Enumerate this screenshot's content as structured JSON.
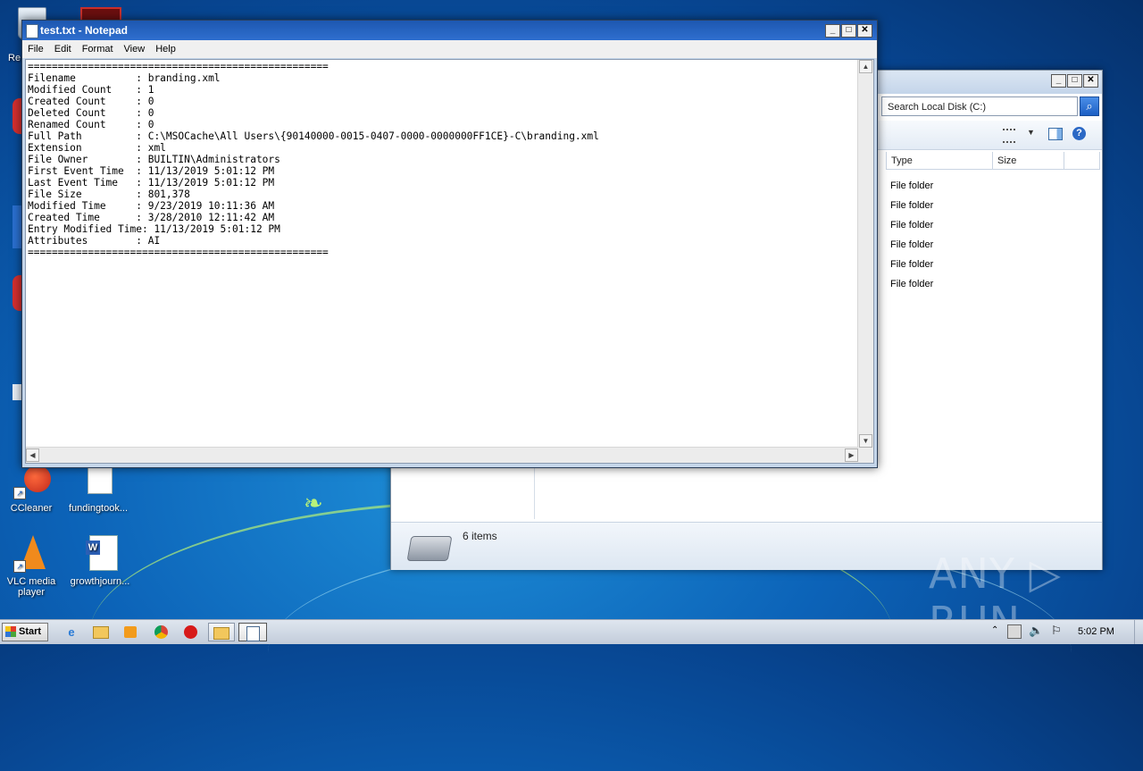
{
  "desktop": {
    "icons": [
      {
        "label": "Re"
      },
      {
        "label": "CCleaner"
      },
      {
        "label": "fundingtook..."
      },
      {
        "label": "VLC media player"
      },
      {
        "label": "growthjourn..."
      }
    ],
    "watermark": "ANY ▷ RUN"
  },
  "notepad": {
    "title": "test.txt - Notepad",
    "menu": [
      "File",
      "Edit",
      "Format",
      "View",
      "Help"
    ],
    "content": "==================================================\nFilename          : branding.xml\nModified Count    : 1\nCreated Count     : 0\nDeleted Count     : 0\nRenamed Count     : 0\nFull Path         : C:\\MSOCache\\All Users\\{90140000-0015-0407-0000-0000000FF1CE}-C\\branding.xml\nExtension         : xml\nFile Owner        : BUILTIN\\Administrators\nFirst Event Time  : 11/13/2019 5:01:12 PM\nLast Event Time   : 11/13/2019 5:01:12 PM\nFile Size         : 801,378\nModified Time     : 9/23/2019 10:11:36 AM\nCreated Time      : 3/28/2010 12:11:42 AM\nEntry Modified Time: 11/13/2019 5:01:12 PM\nAttributes        : AI\n=================================================="
  },
  "explorer": {
    "search_placeholder": "Search Local Disk (C:)",
    "columns": [
      "Type",
      "Size"
    ],
    "rows": [
      "File folder",
      "File folder",
      "File folder",
      "File folder",
      "File folder",
      "File folder"
    ],
    "status": "6 items"
  },
  "taskbar": {
    "start_label": "Start",
    "clock": "5:02 PM"
  }
}
